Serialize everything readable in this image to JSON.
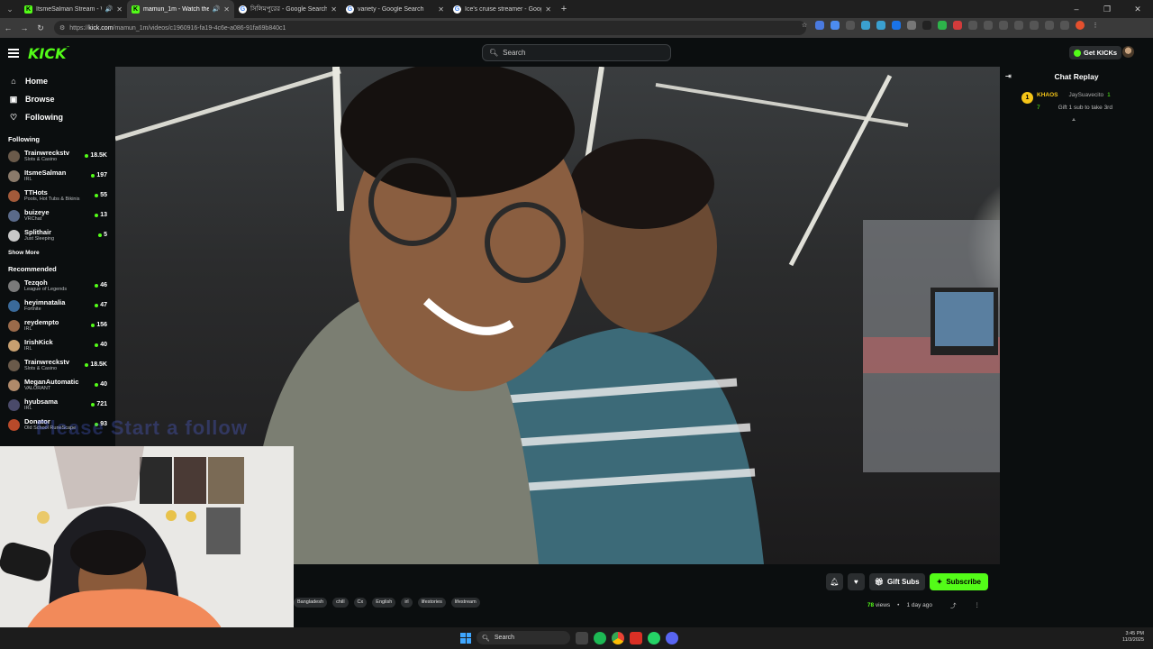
{
  "browser": {
    "tabs": [
      {
        "title": "ItsmeSalman Stream - Watc",
        "icon": "kick-favicon",
        "active": false
      },
      {
        "title": "mamun_1m - Watch the V",
        "icon": "kick-favicon",
        "active": true
      },
      {
        "title": "সিলিমপুরের - Google Search",
        "icon": "google-favicon",
        "active": false
      },
      {
        "title": "variety - Google Search",
        "icon": "google-favicon",
        "active": false
      },
      {
        "title": "Ice's cruise streamer - Google S",
        "icon": "google-favicon",
        "active": false
      }
    ],
    "new_tab": "+",
    "url_prefix": "https://",
    "url_domain": "kick.com",
    "url_path": "/mamun_1m/videos/c1960916-fa19-4c6e-a086-91fa69b840c1"
  },
  "header": {
    "logo": "KICK",
    "logo_tm": "™",
    "search_placeholder": "Search",
    "get_kicks": "Get KICKs"
  },
  "sidebar": {
    "nav": [
      {
        "label": "Home",
        "icon": "home-icon"
      },
      {
        "label": "Browse",
        "icon": "browse-icon"
      },
      {
        "label": "Following",
        "icon": "heart-icon"
      }
    ],
    "following_title": "Following",
    "following": [
      {
        "name": "Trainwreckstv",
        "category": "Slots & Casino",
        "viewers": "18.5K",
        "color": "#6a5a4a"
      },
      {
        "name": "ItsmeSalman",
        "category": "IRL",
        "viewers": "197",
        "color": "#8a7a6a"
      },
      {
        "name": "TTHots",
        "category": "Pools, Hot Tubs & Bikinis",
        "viewers": "55",
        "color": "#a25a3a"
      },
      {
        "name": "buizeye",
        "category": "VRChat",
        "viewers": "13",
        "color": "#5a6a8a"
      },
      {
        "name": "Splithair",
        "category": "Just Sleeping",
        "viewers": "5",
        "color": "#c8c8c8"
      }
    ],
    "show_more": "Show More",
    "recommended_title": "Recommended",
    "recommended": [
      {
        "name": "Tezqoh",
        "category": "League of Legends",
        "viewers": "46",
        "color": "#7a7a7a"
      },
      {
        "name": "heyimnatalia",
        "category": "Fortnite",
        "viewers": "47",
        "color": "#3a6a9a"
      },
      {
        "name": "reydempto",
        "category": "IRL",
        "viewers": "156",
        "color": "#9a6a4a"
      },
      {
        "name": "IrishKick",
        "category": "IRL",
        "viewers": "40",
        "color": "#c8a070"
      },
      {
        "name": "Trainwreckstv",
        "category": "Slots & Casino",
        "viewers": "18.5K",
        "color": "#6a5a4a"
      },
      {
        "name": "MeganAutomatic",
        "category": "VALORANT",
        "viewers": "40",
        "color": "#b08a6a"
      },
      {
        "name": "hyubsama",
        "category": "IRL",
        "viewers": "721",
        "color": "#4a4a6a"
      },
      {
        "name": "Donator",
        "category": "Old School RuneScape",
        "viewers": "93",
        "color": "#b84a2a"
      }
    ]
  },
  "video": {
    "overlay_text": "Please Start a follow"
  },
  "below_video": {
    "gift_subs": "Gift Subs",
    "subscribe": "Subscribe",
    "tags": [
      "Bangladesh",
      "chill",
      "Cx",
      "English",
      "irl",
      "lifestories",
      "lifestream"
    ],
    "views_count": "78",
    "views_label": "views",
    "age": "1 day ago"
  },
  "chat": {
    "title": "Chat Replay",
    "rank": "1",
    "gifter": "KHAOS",
    "gifter_count": "7",
    "recipient": "JaySuavecito",
    "recipient_count": "1",
    "message": "Gift 1 sub to take 3rd"
  },
  "taskbar": {
    "search": "Search",
    "time": "3:45 PM",
    "date": "11/3/2025"
  }
}
